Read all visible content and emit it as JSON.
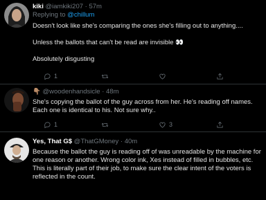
{
  "tweets": [
    {
      "name": "kiki",
      "handle": "@iamkiki207",
      "sep": "·",
      "time": "57m",
      "reply_prefix": "Replying to",
      "reply_handle": "@chillum",
      "paragraphs": [
        "Doesn't look like she's comparing the ones she's filling out to anything....",
        "Unless the ballots that can't be read are invisible 👀",
        "Absolutely disgusting"
      ],
      "reply_count": "1",
      "retweet_count": "",
      "like_count": ""
    },
    {
      "name": "👇🏽",
      "handle": "@woodenhandsicle",
      "sep": "·",
      "time": "48m",
      "paragraphs": [
        "She's copying the ballot of the guy across from her. He's reading off names. Each one is identical to his. Not sure why.."
      ],
      "reply_count": "1",
      "retweet_count": "",
      "like_count": "3"
    },
    {
      "name": "Yes, That G$",
      "handle": "@ThatGMoney",
      "sep": "·",
      "time": "40m",
      "paragraphs": [
        "Because the ballot the guy is reading off of was unreadable by the machine for one reason or another. Wrong color ink, Xes instead of filled in bubbles, etc. This is literally part of their job, to make sure the clear intent of the voters is reflected in the count."
      ],
      "reply_count": "",
      "retweet_count": "",
      "like_count": ""
    }
  ]
}
